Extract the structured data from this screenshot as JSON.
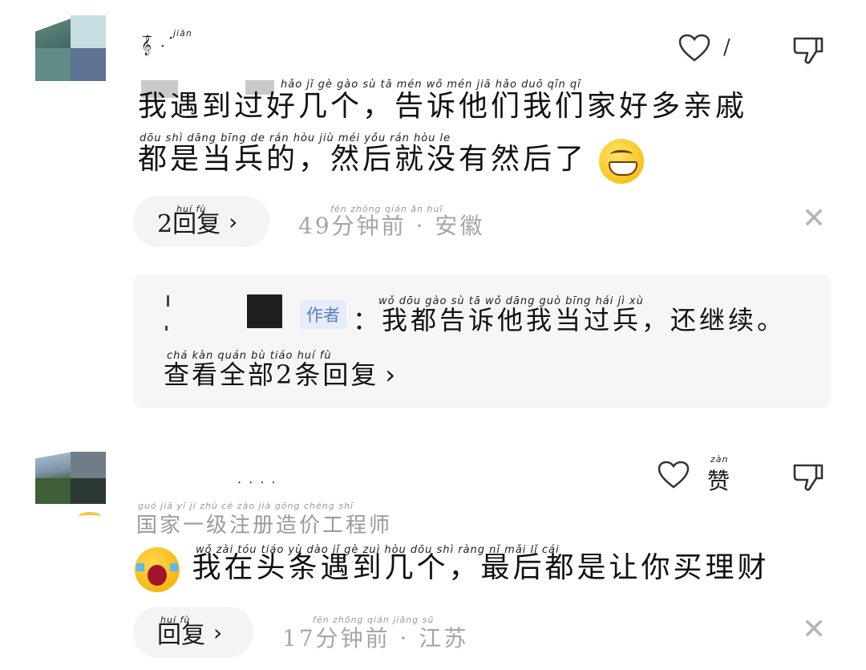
{
  "comments": [
    {
      "username": "𝄞̅ ‧˙ ",
      "username_pinyin": "jiān",
      "like_count": "/",
      "text_line1": "我遇到过好几个，告诉他们我们家好多亲戚",
      "text_line1_pinyin": "hǎo   jǐ   gè      gào   sù   tā  mén  wǒ  mén  jiā  hǎo  duō  qīn  qī",
      "text_line2": "都是当兵的，然后就没有然后了",
      "text_line2_pinyin": "dōu  shì  dāng bīng  de        rán  hòu  jiù  méi  yǒu  rán  hòu   le",
      "emoji": "grinning-face",
      "reply_button": "2回复",
      "reply_button_pinyin": "huí  fù",
      "meta": "49分钟前 · 安徽",
      "meta_pinyin": "fēn zhōng qián      ān  huī"
    },
    {
      "username": "‧ ‧  ‧ ‧ ",
      "like_label": "赞",
      "like_label_pinyin": "zàn",
      "profession": "国家一级注册造价工程师",
      "profession_pinyin": "guó  jiā   yī   jí  zhù  cè  zào  jià  gōng chéng shī",
      "emoji": "crying-face",
      "text": "我在头条遇到几个，最后都是让你买理财",
      "text_pinyin": "wǒ  zài  tóu  tiáo  yù  dào   jǐ   gè       zuì  hòu  dōu  shì  ràng  nǐ   mǎi   lǐ   cái",
      "reply_button": "回复",
      "reply_button_pinyin": "huí  fù",
      "meta": "17分钟前 · 江苏",
      "meta_pinyin": "fēn zhōng qián      jiāng  sū"
    }
  ],
  "reply_preview": {
    "author_badge": "作者",
    "text": "：我都告诉他我当过兵，还继续。",
    "text_pinyin": "wǒ  dōu  gào  sù   tā   wǒ  dāng guò bīng       hái   jì   xù",
    "view_all": "查看全部2条回复",
    "view_all_pinyin": "chá  kàn quán  bù       tiáo  huí  fù",
    "view_all_chevron": "›"
  },
  "icons": [
    "heart-outline-icon",
    "thumbs-down-icon",
    "chevron-right-icon",
    "close-icon"
  ],
  "colors": {
    "author_badge": "#5a80c4",
    "meta": "#a6a6a6",
    "reply_box_bg": "#f6f6f6"
  }
}
